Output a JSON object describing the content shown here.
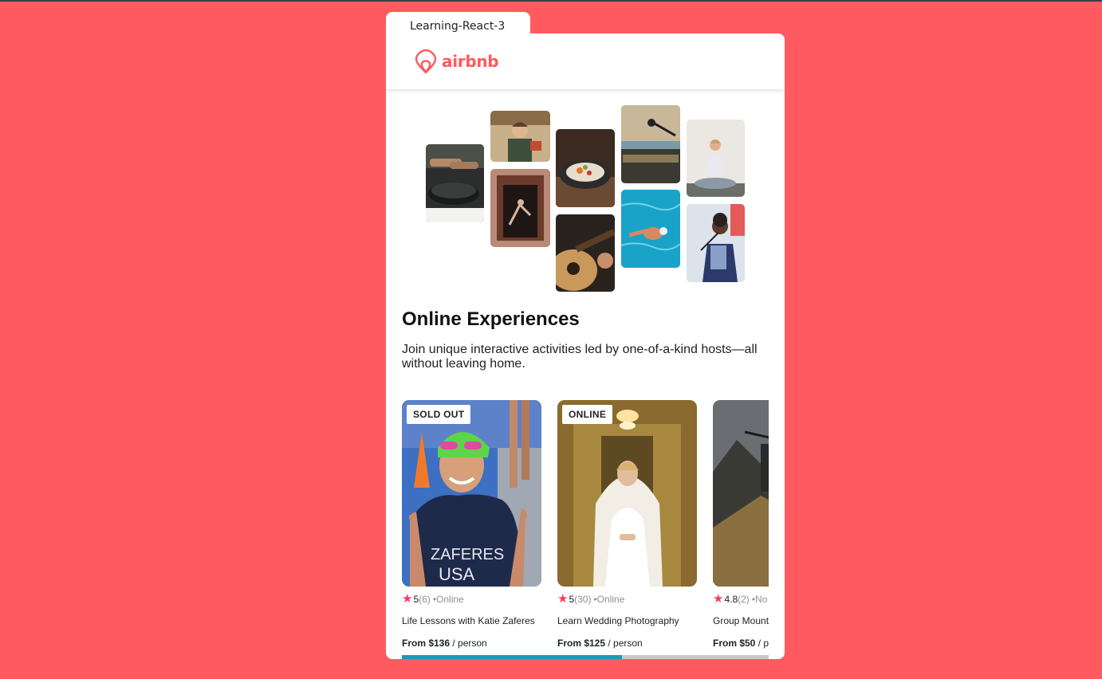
{
  "window": {
    "tab_title": "Learning-React-3"
  },
  "navbar": {
    "brand": "airbnb",
    "logo_icon": "airbnb-belo-icon",
    "brand_color": "#FF5A5F"
  },
  "hero": {
    "title": "Online Experiences",
    "subtitle": "Join unique interactive activities led by one-of-a-kind hosts—all without leaving home.",
    "photos": [
      "cooking-pan-photo",
      "woman-chef-photo",
      "dancer-doorway-photo",
      "plated-dish-photo",
      "guitar-photo",
      "microphone-photo",
      "swimmer-photo",
      "meditation-photo",
      "singer-photo"
    ]
  },
  "cards": [
    {
      "badge": "SOLD OUT",
      "rating": "5",
      "reviews": "(6)",
      "location": "•Online",
      "title": "Life Lessons with Katie Zaferes",
      "price_bold": "From $136",
      "price_rest": " / person",
      "photo": "swimmer-athlete-photo"
    },
    {
      "badge": "ONLINE",
      "rating": "5",
      "reviews": "(30)",
      "location": "•Online",
      "title": "Learn Wedding Photography",
      "price_bold": "From $125",
      "price_rest": " / person",
      "photo": "bride-photo"
    },
    {
      "badge": "",
      "rating": "4.8",
      "reviews": "(2)",
      "location": "•No",
      "title": "Group Mount",
      "price_bold": "From $50",
      "price_rest": " / p",
      "photo": "mountain-biker-photo"
    }
  ],
  "scrollbar": {
    "position": 0.6
  },
  "colors": {
    "background": "#FF5A5F",
    "star": "#FE395C",
    "scroll_thumb": "#1a9bb0"
  }
}
